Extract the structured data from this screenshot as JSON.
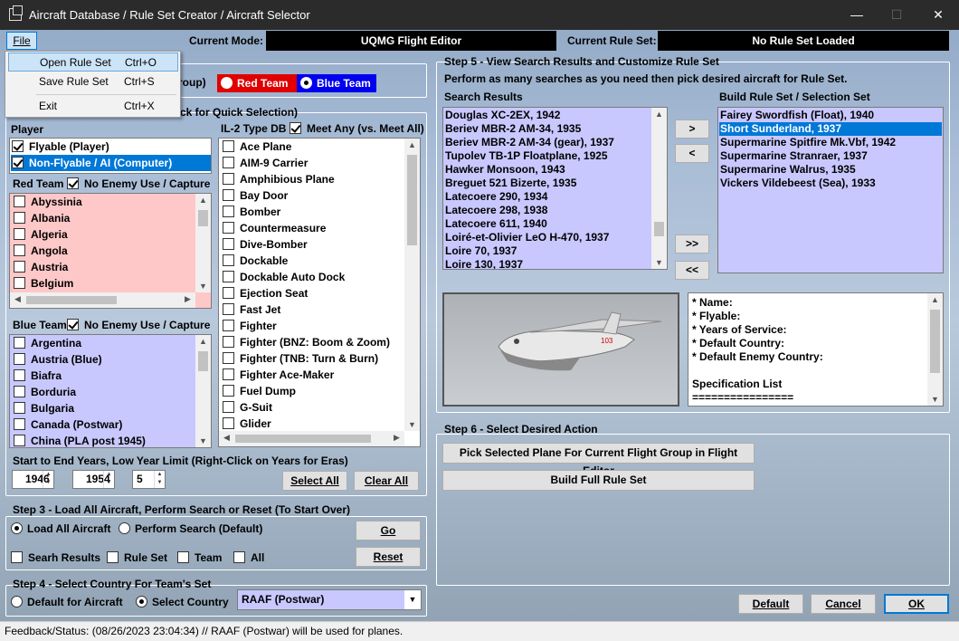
{
  "window": {
    "title": "Aircraft Database / Rule Set Creator / Aircraft Selector",
    "minimize": "—",
    "maximize": "☐",
    "close": "✕"
  },
  "menu": {
    "file": "File",
    "items": [
      {
        "label": "Open Rule Set",
        "shortcut": "Ctrl+O"
      },
      {
        "label": "Save Rule Set",
        "shortcut": "Ctrl+S"
      },
      {
        "label": "Exit",
        "shortcut": "Ctrl+X"
      }
    ]
  },
  "header": {
    "current_mode_label": "Current Mode:",
    "current_mode": "UQMG Flight Editor",
    "current_rule_set_label": "Current Rule Set:",
    "current_rule_set": "No Rule Set Loaded"
  },
  "step1": {
    "hidden_tail": "roup)",
    "red_team": "Red Team",
    "blue_team": "Blue Team"
  },
  "step2": {
    "title_tail": "ck for Quick Selection)",
    "player": {
      "title": "Player",
      "items": [
        {
          "label": "Flyable (Player)",
          "checked": true
        },
        {
          "label": "Non-Flyable / AI (Computer)",
          "checked": true
        }
      ]
    },
    "red_team": {
      "title": "Red Team",
      "no_enemy": "No Enemy Use / Capture",
      "items": [
        "Abyssinia",
        "Albania",
        "Algeria",
        "Angola",
        "Austria",
        "Belgium"
      ]
    },
    "blue_team": {
      "title": "Blue Team",
      "no_enemy": "No Enemy Use / Capture",
      "items": [
        "Argentina",
        "Austria (Blue)",
        "Biafra",
        "Borduria",
        "Bulgaria",
        "Canada (Postwar)",
        "China (PLA post 1945)"
      ]
    },
    "type_db": {
      "title": "IL-2 Type DB",
      "meet_any": "Meet Any (vs. Meet All)",
      "items": [
        "Ace Plane",
        "AIM-9 Carrier",
        "Amphibious Plane",
        "Bay Door",
        "Bomber",
        "Countermeasure",
        "Dive-Bomber",
        "Dockable",
        "Dockable Auto Dock",
        "Ejection Seat",
        "Fast Jet",
        "Fighter",
        "Fighter (BNZ: Boom & Zoom)",
        "Fighter (TNB: Turn & Burn)",
        "Fighter Ace-Maker",
        "Fuel Dump",
        "G-Suit",
        "Glider"
      ]
    },
    "years": {
      "label": "Start to End Years, Low Year Limit (Right-Click on Years for Eras)",
      "start": "1946",
      "end": "1954",
      "limit": "5"
    },
    "select_all": "Select All",
    "clear_all": "Clear All"
  },
  "step3": {
    "title": "Step 3 - Load All Aircraft, Perform Search or Reset (To Start Over)",
    "load_all": "Load All Aircraft",
    "perform_search": "Perform Search (Default)",
    "go": "Go",
    "reset": "Reset",
    "search_results": "Searh Results",
    "rule_set": "Rule Set",
    "team": "Team",
    "all": "All"
  },
  "step4": {
    "title": "Step 4 - Select Country For Team's Set",
    "default": "Default for Aircraft",
    "select_country": "Select Country",
    "country": "RAAF (Postwar)"
  },
  "step5": {
    "title": "Step 5 - View Search Results and Customize Rule Set",
    "instructions": "Perform as many searches as you need then pick desired aircraft for Rule Set.",
    "search_results_title": "Search Results",
    "search_results": [
      "Douglas XC-2EX, 1942",
      "Beriev MBR-2 AM-34, 1935",
      "Beriev MBR-2 AM-34 (gear), 1937",
      "Tupolev TB-1P Floatplane, 1925",
      "Hawker Monsoon, 1943",
      "Breguet 521 Bizerte, 1935",
      "Latecoere 290, 1934",
      "Latecoere 298, 1938",
      "Latecoere 611, 1940",
      "Loiré-et-Olivier LeO H-470, 1937",
      "Loire 70, 1937",
      "Loire 130, 1937"
    ],
    "rule_set_title": "Build Rule Set / Selection  Set",
    "rule_set": [
      "Fairey Swordfish (Float), 1940",
      "Short Sunderland, 1937",
      "Supermarine Spitfire Mk.Vbf, 1942",
      "Supermarine Stranraer, 1937",
      "Supermarine Walrus, 1935",
      "Vickers Vildebeest (Sea), 1933"
    ],
    "selected_index": 1,
    "btn_add": ">",
    "btn_remove": "<",
    "btn_add_all": ">>",
    "btn_remove_all": "<<",
    "details": [
      "* Name:",
      "* Flyable:",
      "* Years of Service:",
      "* Default Country:",
      "* Default Enemy Country:",
      "",
      "Specification List",
      "================"
    ]
  },
  "step6": {
    "title": "Step 6 - Select Desired Action",
    "pick": "Pick Selected Plane For Current Flight Group in Flight Editor",
    "build": "Build Full Rule Set"
  },
  "footer": {
    "default": "Default",
    "cancel": "Cancel",
    "ok": "OK"
  },
  "status": {
    "text": "Feedback/Status:  (08/26/2023 23:04:34) // RAAF (Postwar) will be used for planes."
  }
}
